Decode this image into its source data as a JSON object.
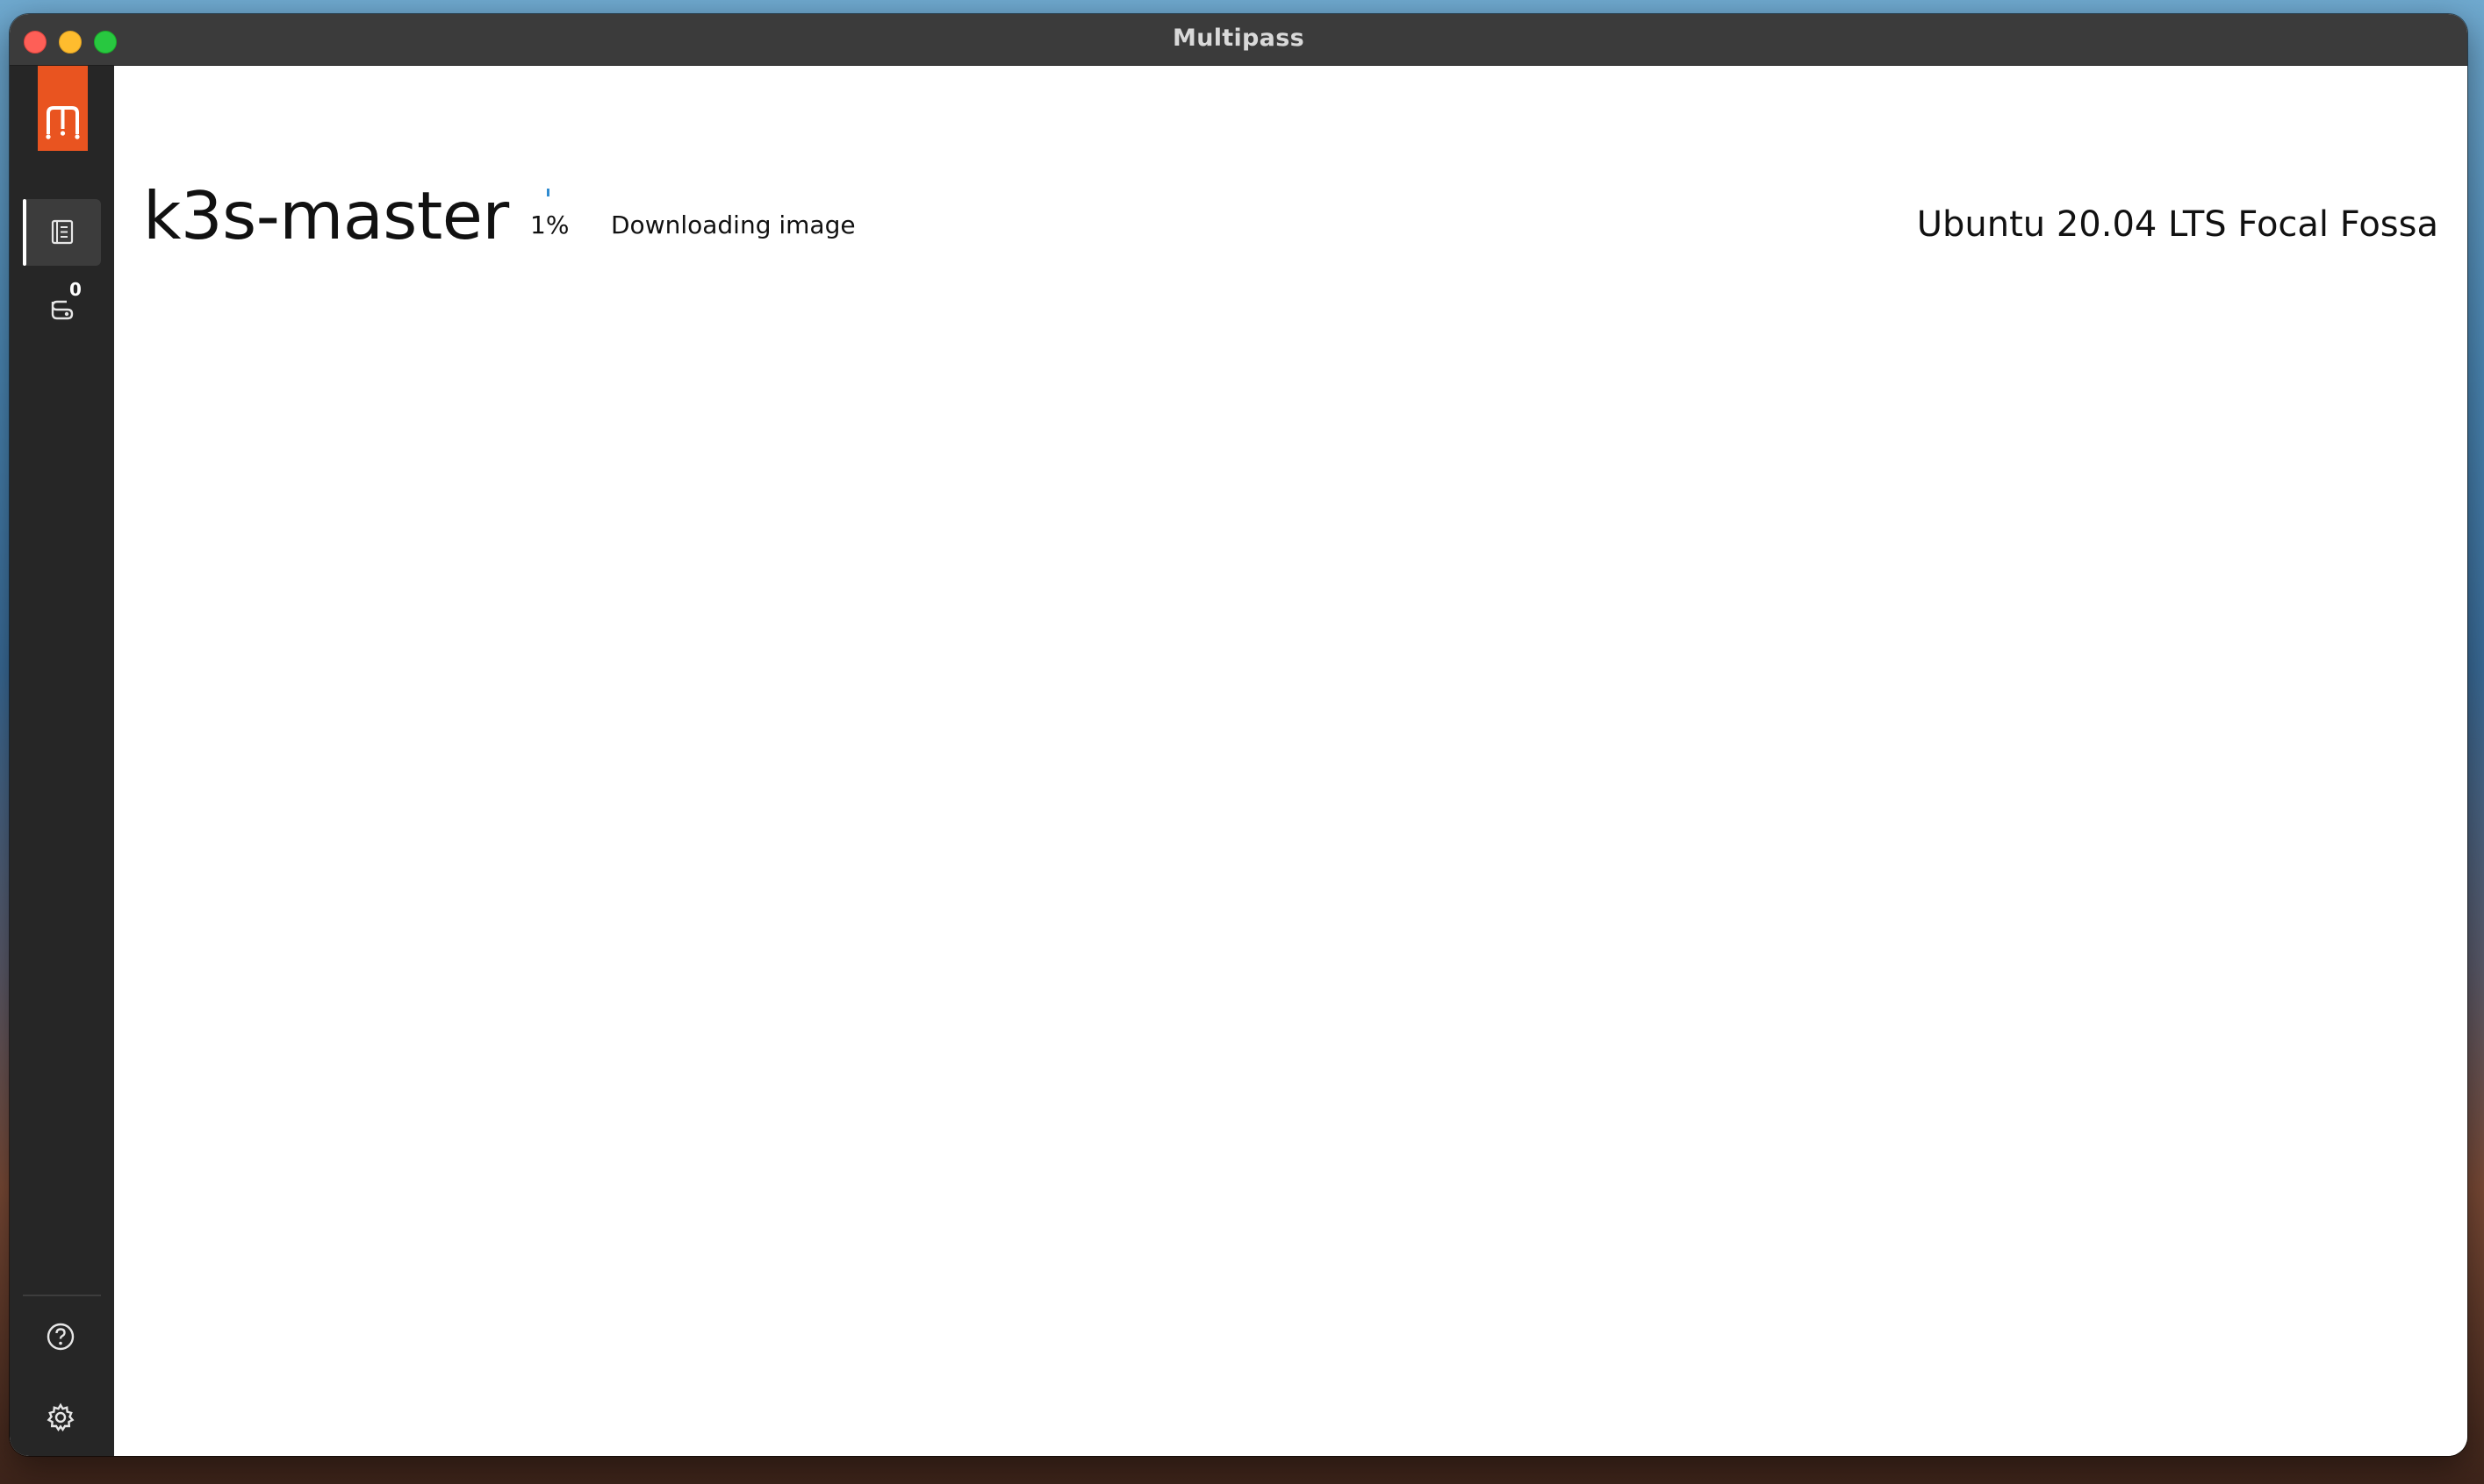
{
  "window": {
    "title": "Multipass"
  },
  "sidebar": {
    "logo_letter": "m",
    "instances_badge_count": "0",
    "items": [
      {
        "name": "instances",
        "icon": "instances-list-icon"
      },
      {
        "name": "mounts",
        "icon": "mounts-icon"
      },
      {
        "name": "help",
        "icon": "help-circle-icon"
      },
      {
        "name": "settings",
        "icon": "gear-icon"
      }
    ]
  },
  "instance": {
    "name": "k3s-master",
    "progress_percent": "1%",
    "progress_fraction": 0.01,
    "status": "Downloading image",
    "release": "Ubuntu 20.04 LTS Focal Fossa"
  },
  "colors": {
    "accent": "#e95420",
    "sidebar_bg": "#262626",
    "progress": "#2f8bd0"
  }
}
